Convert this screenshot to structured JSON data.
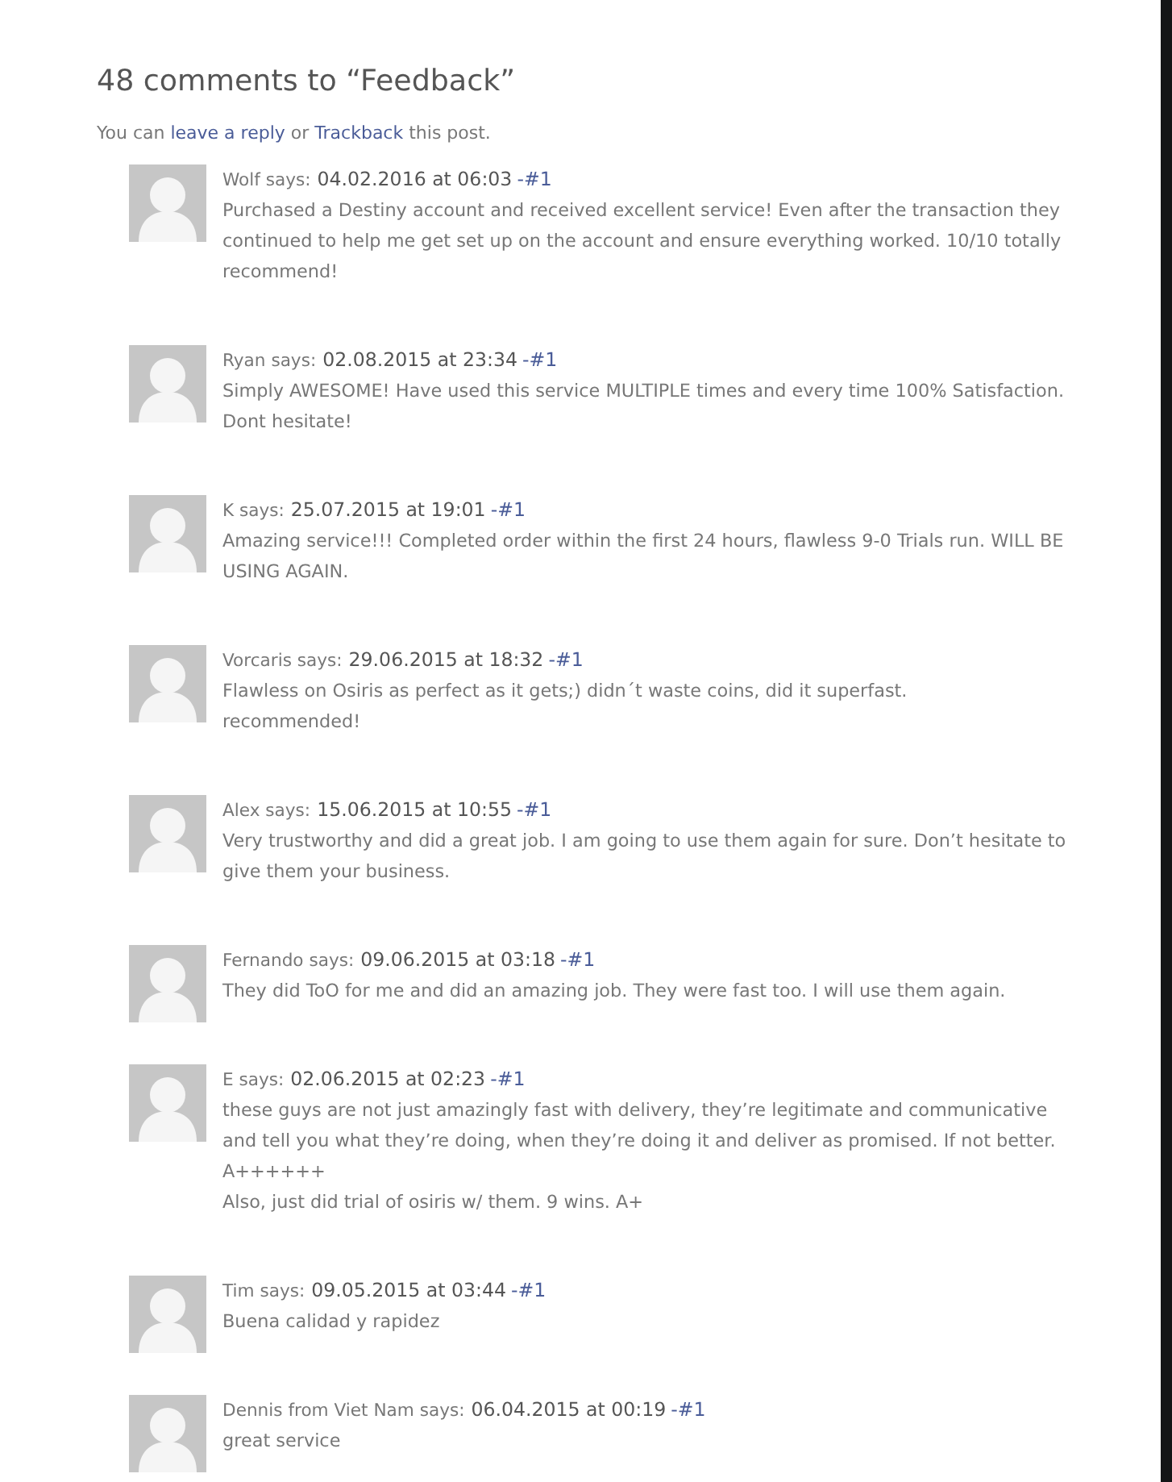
{
  "heading": "48 comments to “Feedback”",
  "intro": [
    {
      "kind": "text",
      "text": "You can"
    },
    {
      "kind": "link",
      "text": "leave a reply"
    },
    {
      "kind": "text",
      "text": "or"
    },
    {
      "kind": "link",
      "text": "Trackback"
    },
    {
      "kind": "text",
      "text": "this post."
    }
  ],
  "comments": [
    {
      "author": "Wolf",
      "verb": "says:",
      "date": "04.02.2016 at 06:03",
      "permalink": "-#1",
      "body": [
        "Purchased a Destiny account and received excellent service! Even after the transaction they continued to help me get set up on the account and ensure everything worked. 10/10 totally recommend!"
      ]
    },
    {
      "author": "Ryan",
      "verb": "says:",
      "date": "02.08.2015 at 23:34",
      "permalink": "-#1",
      "body": [
        "Simply AWESOME! Have used this service MULTIPLE times and every time 100% Satisfaction. Dont hesitate!"
      ]
    },
    {
      "author": "K",
      "verb": "says:",
      "date": "25.07.2015 at 19:01",
      "permalink": "-#1",
      "body": [
        "Amazing service!!! Completed order within the first 24 hours, flawless 9-0 Trials run. WILL BE USING AGAIN."
      ]
    },
    {
      "author": "Vorcaris",
      "verb": "says:",
      "date": "29.06.2015 at 18:32",
      "permalink": "-#1",
      "body": [
        "Flawless on Osiris as perfect as it gets;) didn´t waste coins, did it superfast.",
        "recommended!"
      ]
    },
    {
      "author": "Alex",
      "verb": "says:",
      "date": "15.06.2015 at 10:55",
      "permalink": "-#1",
      "body": [
        "Very trustworthy and did a great job. I am going to use them again for sure. Don’t hesitate to give them your business."
      ]
    },
    {
      "author": "Fernando",
      "verb": "says:",
      "date": "09.06.2015 at 03:18",
      "permalink": "-#1",
      "body": [
        "They did ToO for me and did an amazing job. They were fast too. I will use them again."
      ]
    },
    {
      "author": "E",
      "verb": "says:",
      "date": "02.06.2015 at 02:23",
      "permalink": "-#1",
      "body": [
        "these guys are not just amazingly fast with delivery, they’re legitimate and communicative and tell you what they’re doing, when they’re doing it and deliver as promised. If not better. A++++++",
        "Also, just did trial of osiris w/ them. 9 wins. A+"
      ]
    },
    {
      "author": "Tim",
      "verb": "says:",
      "date": "09.05.2015 at 03:44",
      "permalink": "-#1",
      "body": [
        "Buena calidad y rapidez"
      ]
    },
    {
      "author": "Dennis from Viet Nam",
      "verb": "says:",
      "date": "06.04.2015 at 00:19",
      "permalink": "-#1",
      "body": [
        "great service"
      ]
    }
  ]
}
